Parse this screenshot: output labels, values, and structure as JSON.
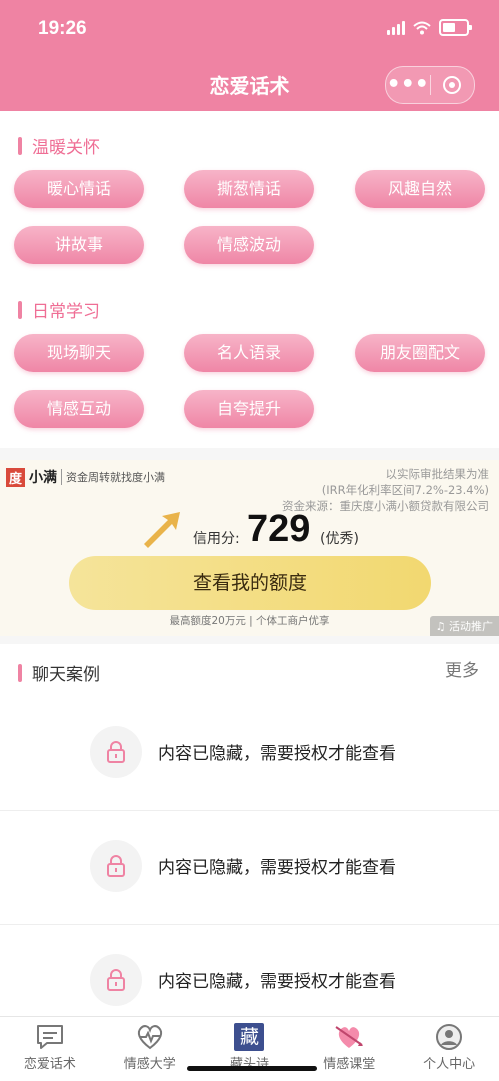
{
  "status": {
    "time": "19:26"
  },
  "header": {
    "title": "恋爱话术"
  },
  "capsule": {
    "more": "•••"
  },
  "warm": {
    "title": "温暖关怀",
    "chips": [
      "暖心情话",
      "撕葱情话",
      "风趣自然",
      "讲故事",
      "情感波动"
    ]
  },
  "daily": {
    "title": "日常学习",
    "chips": [
      "现场聊天",
      "名人语录",
      "朋友圈配文",
      "情感互动",
      "自夸提升"
    ]
  },
  "ad": {
    "logo_mark": "度",
    "brand": "小满",
    "slogan": "资金周转就找度小满",
    "note1": "以实际审批结果为准",
    "note2": "(IRR年化利率区间7.2%-23.4%)",
    "note3": "资金来源：重庆度小满小额贷款有限公司",
    "score_label": "信用分:",
    "score": "729",
    "score_rating": "(优秀)",
    "cta": "查看我的额度",
    "footer": "最高额度20万元 | 个体工商户优享",
    "tag": "♫ 活动推广"
  },
  "cases": {
    "title": "聊天案例",
    "more": "更多",
    "items": [
      "内容已隐藏，需要授权才能查看",
      "内容已隐藏，需要授权才能查看",
      "内容已隐藏，需要授权才能查看"
    ]
  },
  "tabs": [
    {
      "label": "恋爱话术",
      "icon": "chat-icon"
    },
    {
      "label": "情感大学",
      "icon": "heart-pulse-icon"
    },
    {
      "label": "藏头诗",
      "icon": "cang-icon",
      "glyph": "藏"
    },
    {
      "label": "情感课堂",
      "icon": "heart-arrow-icon"
    },
    {
      "label": "个人中心",
      "icon": "profile-icon"
    }
  ],
  "colors": {
    "primary": "#ef83a3",
    "accent_text": "#ef6e95",
    "cta": "#f2d870"
  }
}
